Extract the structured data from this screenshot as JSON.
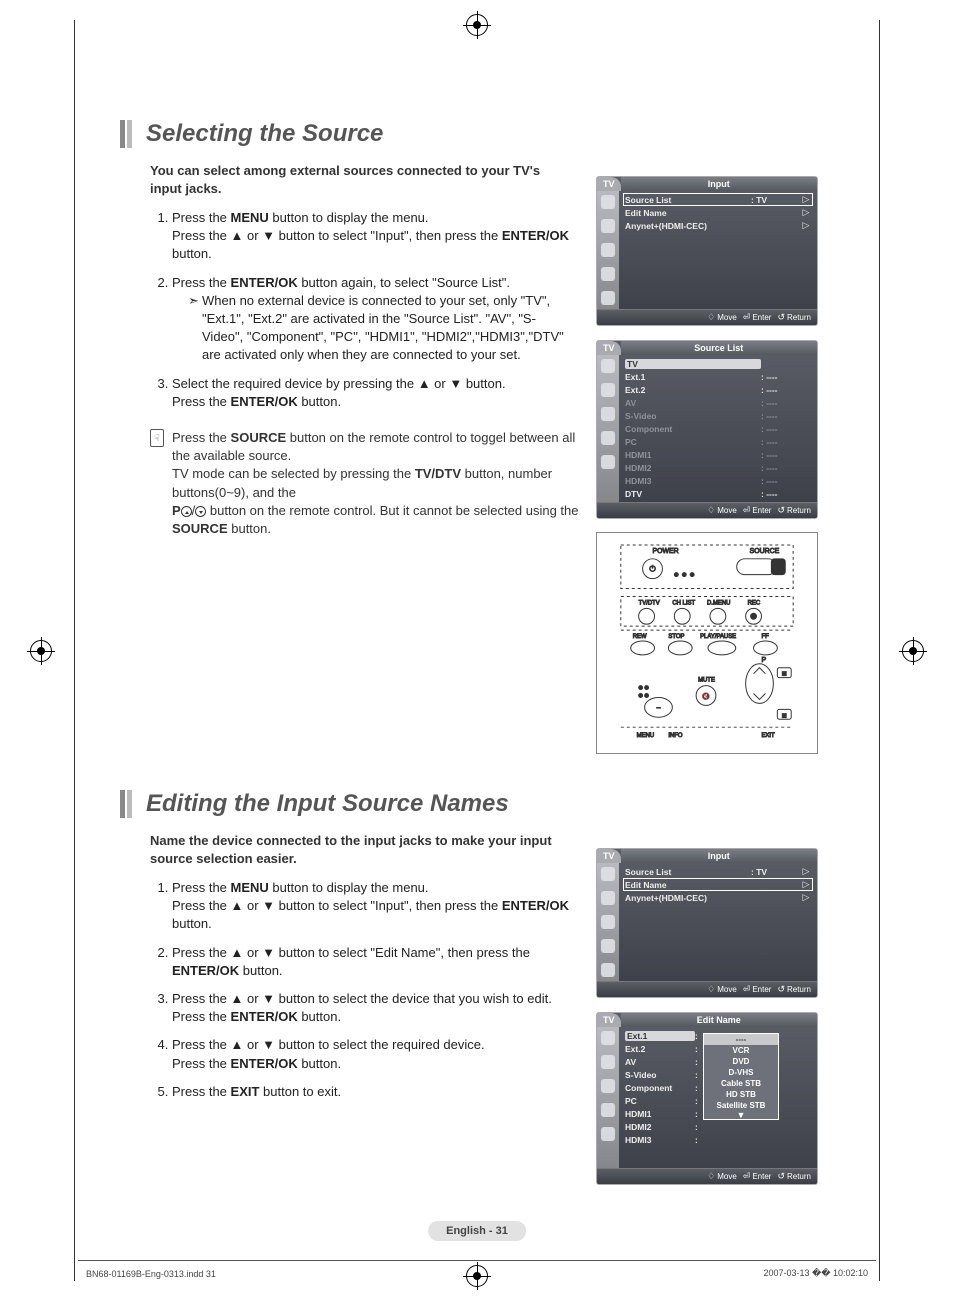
{
  "section1": {
    "title": "Selecting the Source",
    "intro": "You can select among external sources connected to your TV's input jacks.",
    "step1a": "Press the ",
    "step1b": " button to display the menu.",
    "step1c": "Press the ▲ or ▼ button to select \"Input\", then press the ",
    "step1d": " button.",
    "step2a": "Press the ",
    "step2b": " button again, to select \"Source List\".",
    "step2_note": "When no external device is connected to your set, only \"TV\", \"Ext.1\", \"Ext.2\" are activated in the \"Source List\". \"AV\", \"S-Video\", \"Component\", \"PC\", \"HDMI1\", \"HDMI2\",\"HDMI3\",\"DTV\" are activated only when they are connected to your set.",
    "step3a": "Select the required device by pressing the ▲ or ▼ button.",
    "step3b": "Press the ",
    "step3c": " button.",
    "tip1a": "Press the ",
    "tip1b": " button on the remote control to toggel between all the available source.",
    "tip2a": "TV mode can be selected by pressing the ",
    "tip2b": " button, number buttons(0~9), and the",
    "tip3a": " button on the remote control. But it cannot be selected using the ",
    "tip3b": " button.",
    "kw": {
      "menu": "MENU",
      "enterok": "ENTER/OK",
      "source": "SOURCE",
      "tvdtv": "TV/DTV",
      "p": "P"
    }
  },
  "section2": {
    "title": "Editing the Input Source Names",
    "intro": "Name the device connected to the input jacks to make your input source selection easier.",
    "step1a": "Press the ",
    "step1b": " button to display the menu.",
    "step1c": "Press the ▲ or ▼ button to select \"Input\", then press the ",
    "step1d": " button.",
    "step2a": "Press the ▲ or ▼ button to select \"Edit Name\", then press the ",
    "step2b": " button.",
    "step3a": "Press the ▲ or ▼ button to select the device that you wish to edit.",
    "step3b": "Press the ",
    "step3c": " button.",
    "step4a": "Press the ▲ or ▼ button to select the required device.",
    "step4b": "Press the ",
    "step4c": " button.",
    "step5a": "Press the ",
    "step5b": " button to exit.",
    "kw": {
      "menu": "MENU",
      "enterok": "ENTER/OK",
      "exit": "EXIT"
    }
  },
  "osd_input": {
    "tab": "TV",
    "title": "Input",
    "rows": [
      {
        "label": "Source List",
        "value": ": TV"
      },
      {
        "label": "Edit Name",
        "value": ""
      },
      {
        "label": "Anynet+(HDMI-CEC)",
        "value": ""
      }
    ],
    "footer": {
      "move": "Move",
      "enter": "Enter",
      "return": "Return"
    }
  },
  "osd_sourcelist": {
    "tab": "TV",
    "title": "Source List",
    "rows": [
      {
        "label": "TV",
        "value": "",
        "sel": true
      },
      {
        "label": "Ext.1",
        "value": ": ----"
      },
      {
        "label": "Ext.2",
        "value": ": ----"
      },
      {
        "label": "AV",
        "value": ": ----",
        "inactive": true
      },
      {
        "label": "S-Video",
        "value": ": ----",
        "inactive": true
      },
      {
        "label": "Component",
        "value": ": ----",
        "inactive": true
      },
      {
        "label": "PC",
        "value": ": ----",
        "inactive": true
      },
      {
        "label": "HDMI1",
        "value": ": ----",
        "inactive": true
      },
      {
        "label": "HDMI2",
        "value": ": ----",
        "inactive": true
      },
      {
        "label": "HDMI3",
        "value": ": ----",
        "inactive": true
      },
      {
        "label": "DTV",
        "value": ": ----"
      }
    ],
    "footer": {
      "move": "Move",
      "enter": "Enter",
      "return": "Return"
    }
  },
  "osd_input2": {
    "tab": "TV",
    "title": "Input",
    "rows": [
      {
        "label": "Source List",
        "value": ": TV"
      },
      {
        "label": "Edit Name",
        "value": "",
        "hl": true
      },
      {
        "label": "Anynet+(HDMI-CEC)",
        "value": ""
      }
    ],
    "footer": {
      "move": "Move",
      "enter": "Enter",
      "return": "Return"
    }
  },
  "osd_editname": {
    "tab": "TV",
    "title": "Edit Name",
    "rows": [
      {
        "label": "Ext.1",
        "value": ":",
        "sel": true
      },
      {
        "label": "Ext.2",
        "value": ":"
      },
      {
        "label": "AV",
        "value": ":"
      },
      {
        "label": "S-Video",
        "value": ":"
      },
      {
        "label": "Component",
        "value": ":"
      },
      {
        "label": "PC",
        "value": ":"
      },
      {
        "label": "HDMI1",
        "value": ":"
      },
      {
        "label": "HDMI2",
        "value": ":"
      },
      {
        "label": "HDMI3",
        "value": ":"
      }
    ],
    "popup": [
      "----",
      "VCR",
      "DVD",
      "D-VHS",
      "Cable STB",
      "HD STB",
      "Satellite STB"
    ],
    "footer": {
      "move": "Move",
      "enter": "Enter",
      "return": "Return"
    }
  },
  "remote_labels": {
    "power": "POWER",
    "source": "SOURCE",
    "tvdtv": "TV/DTV",
    "chlist": "CH LIST",
    "dmenu": "D.MENU",
    "rec": "REC",
    "rew": "REW",
    "stop": "STOP",
    "playpause": "PLAY/PAUSE",
    "ff": "FF",
    "p": "P",
    "mute": "MUTE",
    "menu": "MENU",
    "info": "INFO",
    "exit": "EXIT"
  },
  "page_number": "English - 31",
  "footer_left": "BN68-01169B-Eng-0313.indd   31",
  "footer_right": "2007-03-13   �� 10:02:10"
}
